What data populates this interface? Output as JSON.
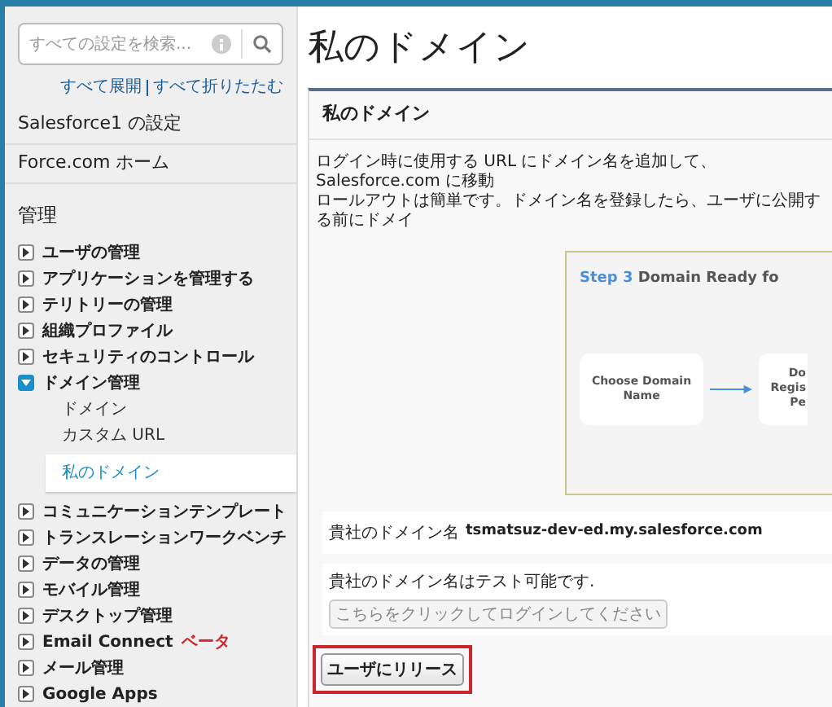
{
  "sidebar": {
    "search": {
      "placeholder": "すべての設定を検索..."
    },
    "links": [
      "すべて展開",
      "すべて折りたたむ"
    ],
    "sections": [
      {
        "title": "Salesforce1 の設定"
      },
      {
        "title": "Force.com ホーム"
      }
    ],
    "group_title": "管理",
    "items": [
      {
        "label": "ユーザの管理",
        "expanded": false
      },
      {
        "label": "アプリケーションを管理する",
        "expanded": false
      },
      {
        "label": "テリトリーの管理",
        "expanded": false
      },
      {
        "label": "組織プロファイル",
        "expanded": false
      },
      {
        "label": "セキュリティのコントロール",
        "expanded": false
      },
      {
        "label": "ドメイン管理",
        "expanded": true,
        "children": [
          {
            "label": "ドメイン",
            "selected": false
          },
          {
            "label": "カスタム URL",
            "selected": false
          },
          {
            "label": "私のドメイン",
            "selected": true
          }
        ]
      },
      {
        "label": "コミュニケーションテンプレート",
        "expanded": false
      },
      {
        "label": "トランスレーションワークベンチ",
        "expanded": false
      },
      {
        "label": "データの管理",
        "expanded": false
      },
      {
        "label": "モバイル管理",
        "expanded": false
      },
      {
        "label": "デスクトップ管理",
        "expanded": false
      },
      {
        "label": "Email Connect",
        "badge": "ベータ",
        "expanded": false
      },
      {
        "label": "メール管理",
        "expanded": false
      },
      {
        "label": "Google Apps",
        "expanded": false
      }
    ]
  },
  "page_title": "私のドメイン",
  "panel": {
    "title": "私のドメイン",
    "description": [
      "ログイン時に使用する URL にドメイン名を追加して、Salesforce.com に移動",
      "ロールアウトは簡単です。ドメイン名を登録したら、ユーザに公開する前にドメイ"
    ],
    "diagram": {
      "step": "Step 3",
      "heading": "Domain Ready fo",
      "nodes": [
        [
          "Choose Domain",
          "Name"
        ],
        [
          "Do",
          "Regis",
          "Pe"
        ]
      ]
    },
    "domain_label": "貴社のドメイン名",
    "domain_value": "tsmatsuz-dev-ed.my.salesforce.com",
    "test_text": "貴社のドメイン名はテスト可能です.",
    "test_button": "こちらをクリックしてログインしてください",
    "release_button": "ユーザにリリース"
  }
}
